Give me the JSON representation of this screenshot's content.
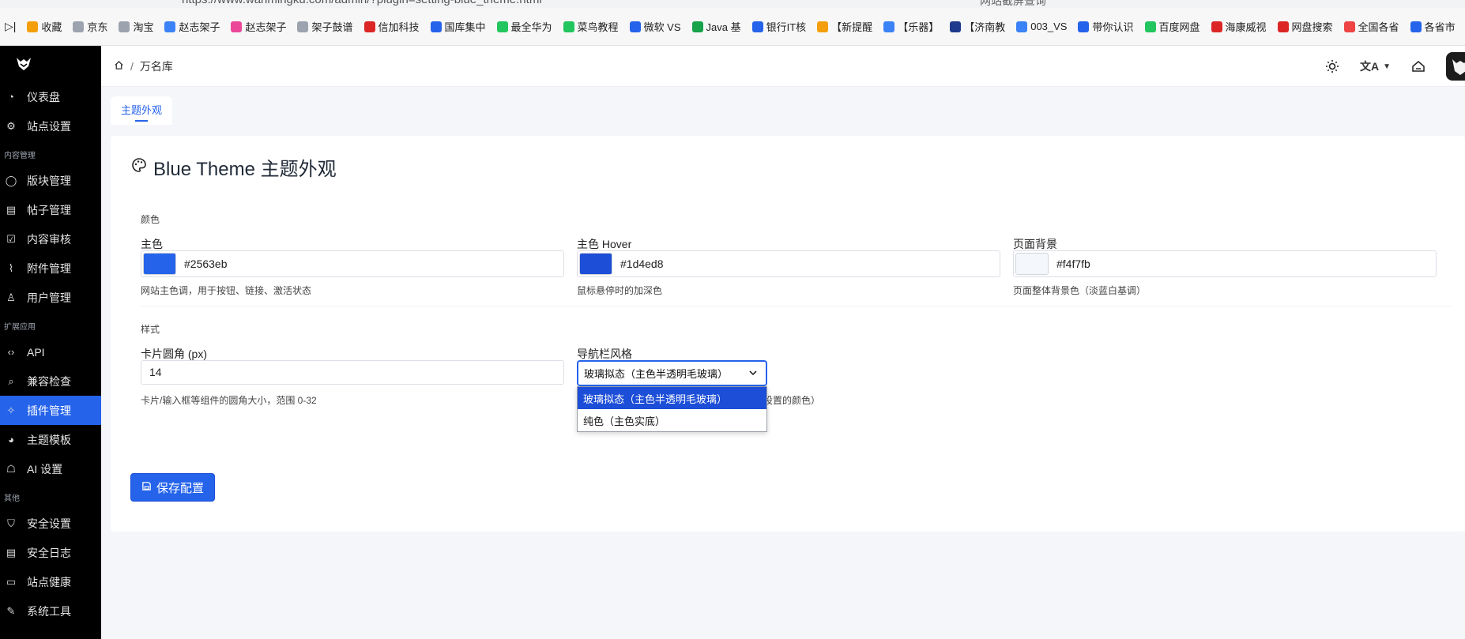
{
  "browser": {
    "url": "https://www.wanmingku.com/admin/?plugin=setting-blue_theme.html",
    "search_placeholder": "网站截屏查询",
    "bookmarks": [
      {
        "label": "收藏",
        "color": "#f59e0b"
      },
      {
        "label": "京东",
        "color": "#9ca3af"
      },
      {
        "label": "淘宝",
        "color": "#9ca3af"
      },
      {
        "label": "赵志架子",
        "color": "#3b82f6"
      },
      {
        "label": "赵志架子",
        "color": "#ec4899"
      },
      {
        "label": "架子鼓谱",
        "color": "#9ca3af"
      },
      {
        "label": "信加科技",
        "color": "#dc2626"
      },
      {
        "label": "国库集中",
        "color": "#2563eb"
      },
      {
        "label": "最全华为",
        "color": "#22c55e"
      },
      {
        "label": "菜鸟教程",
        "color": "#22c55e"
      },
      {
        "label": "微软 VS",
        "color": "#2563eb"
      },
      {
        "label": "Java 基",
        "color": "#16a34a"
      },
      {
        "label": "银行IT核",
        "color": "#2563eb"
      },
      {
        "label": "【新提醒",
        "color": "#f59e0b"
      },
      {
        "label": "【乐器】",
        "color": "#3b82f6"
      },
      {
        "label": "【济南教",
        "color": "#1e3a8a"
      },
      {
        "label": "003_VS",
        "color": "#3b82f6"
      },
      {
        "label": "带你认识",
        "color": "#2563eb"
      },
      {
        "label": "百度网盘",
        "color": "#22c55e"
      },
      {
        "label": "海康威视",
        "color": "#dc2626"
      },
      {
        "label": "网盘搜索",
        "color": "#dc2626"
      },
      {
        "label": "全国各省",
        "color": "#ef4444"
      },
      {
        "label": "各省市",
        "color": "#2563eb"
      }
    ]
  },
  "sidebar": {
    "items": [
      {
        "type": "item",
        "label": "仪表盘",
        "icon": "dashboard-icon",
        "glyph": "◔"
      },
      {
        "type": "item",
        "label": "站点设置",
        "icon": "gear-icon",
        "glyph": "⚙"
      },
      {
        "type": "group",
        "label": "内容管理"
      },
      {
        "type": "item",
        "label": "版块管理",
        "icon": "chat-bubble-icon",
        "glyph": "◯"
      },
      {
        "type": "item",
        "label": "帖子管理",
        "icon": "document-icon",
        "glyph": "▤"
      },
      {
        "type": "item",
        "label": "内容审核",
        "icon": "clipboard-check-icon",
        "glyph": "☑"
      },
      {
        "type": "item",
        "label": "附件管理",
        "icon": "paperclip-icon",
        "glyph": "⌇"
      },
      {
        "type": "item",
        "label": "用户管理",
        "icon": "users-icon",
        "glyph": "♙"
      },
      {
        "type": "group",
        "label": "扩展应用"
      },
      {
        "type": "item",
        "label": "API",
        "icon": "code-icon",
        "glyph": "‹›"
      },
      {
        "type": "item",
        "label": "兼容检查",
        "icon": "search-icon",
        "glyph": "⌕"
      },
      {
        "type": "item",
        "label": "插件管理",
        "icon": "puzzle-icon",
        "glyph": "✧",
        "active": true
      },
      {
        "type": "item",
        "label": "主题模板",
        "icon": "palette-icon",
        "glyph": "◕"
      },
      {
        "type": "item",
        "label": "AI 设置",
        "icon": "robot-icon",
        "glyph": "☖"
      },
      {
        "type": "group",
        "label": "其他"
      },
      {
        "type": "item",
        "label": "安全设置",
        "icon": "shield-icon",
        "glyph": "⛉"
      },
      {
        "type": "item",
        "label": "安全日志",
        "icon": "log-icon",
        "glyph": "▤"
      },
      {
        "type": "item",
        "label": "站点健康",
        "icon": "monitor-icon",
        "glyph": "▭"
      },
      {
        "type": "item",
        "label": "系统工具",
        "icon": "wrench-icon",
        "glyph": "✎"
      }
    ]
  },
  "header": {
    "breadcrumb_sep": "/",
    "breadcrumb_current": "万名库"
  },
  "tabs": [
    {
      "label": "主题外观"
    }
  ],
  "card": {
    "title": "Blue Theme 主题外观",
    "colors_section": "颜色",
    "primary": {
      "label": "主色",
      "value": "#2563eb",
      "help": "网站主色调，用于按钮、链接、激活状态"
    },
    "primary_hover": {
      "label": "主色 Hover",
      "value": "#1d4ed8",
      "help": "鼠标悬停时的加深色"
    },
    "page_bg": {
      "label": "页面背景",
      "value": "#f4f7fb",
      "help": "页面整体背景色（淡蓝白基调）"
    },
    "style_section": "样式",
    "radius": {
      "label": "卡片圆角 (px)",
      "value": "14",
      "help": "卡片/输入框等组件的圆角大小，范围 0-32"
    },
    "navbar": {
      "label": "导航栏风格",
      "selected": "玻璃拟态（主色半透明毛玻璃）",
      "options": [
        "玻璃拟态（主色半透明毛玻璃）",
        "纯色（主色实底）"
      ],
      "help_tail": "设置的颜色）"
    },
    "save_label": "保存配置"
  }
}
